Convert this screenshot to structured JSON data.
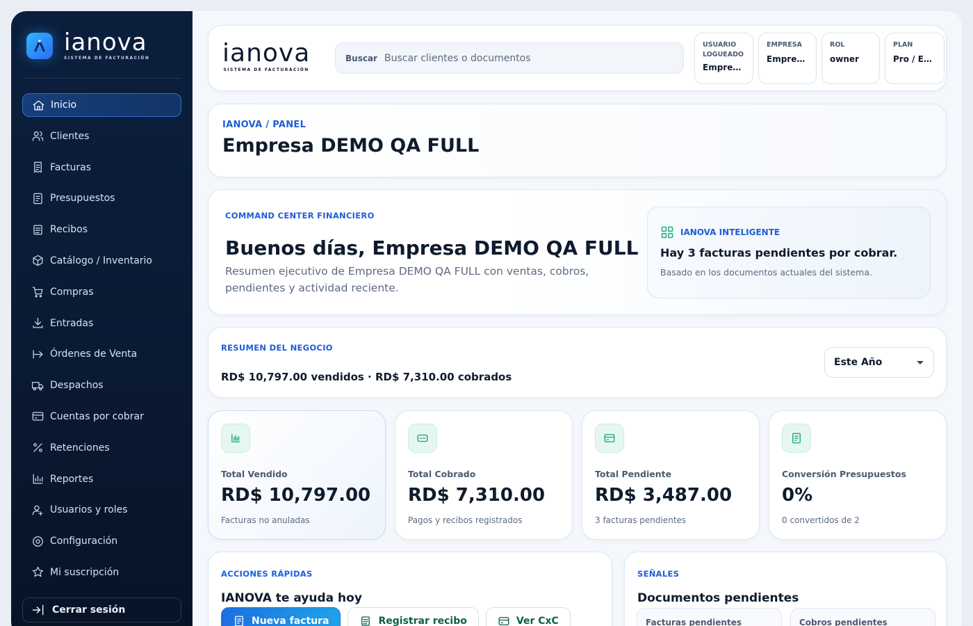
{
  "brand": {
    "name": "ianova",
    "tagline": "SISTEMA DE FACTURACIÓN"
  },
  "nav": {
    "items": [
      {
        "label": "Inicio",
        "icon": "home-icon",
        "active": true
      },
      {
        "label": "Clientes",
        "icon": "users-icon"
      },
      {
        "label": "Facturas",
        "icon": "invoice-icon"
      },
      {
        "label": "Presupuestos",
        "icon": "receipt-icon"
      },
      {
        "label": "Recibos",
        "icon": "document-icon"
      },
      {
        "label": "Catálogo / Inventario",
        "icon": "box-icon"
      },
      {
        "label": "Compras",
        "icon": "cart-icon"
      },
      {
        "label": "Entradas",
        "icon": "download-icon"
      },
      {
        "label": "Órdenes de Venta",
        "icon": "arrow-right-to-icon"
      },
      {
        "label": "Despachos",
        "icon": "truck-icon"
      },
      {
        "label": "Cuentas por cobrar",
        "icon": "credit-card-icon"
      },
      {
        "label": "Retenciones",
        "icon": "percent-icon"
      },
      {
        "label": "Reportes",
        "icon": "bar-chart-icon"
      },
      {
        "label": "Usuarios y roles",
        "icon": "user-gear-icon"
      },
      {
        "label": "Configuración",
        "icon": "settings-icon"
      },
      {
        "label": "Mi suscripción",
        "icon": "star-icon"
      }
    ],
    "logout_label": "Cerrar sesión"
  },
  "topbar": {
    "search_label": "Buscar",
    "search_placeholder": "Buscar clientes o documentos",
    "chips": [
      {
        "key": "USUARIO LOGUEADO",
        "value": "Empres..."
      },
      {
        "key": "EMPRESA",
        "value": "Empres..."
      },
      {
        "key": "ROL",
        "value": "owner"
      },
      {
        "key": "PLAN",
        "value": "Pro / Em..."
      }
    ]
  },
  "panel": {
    "breadcrumb": "IANOVA / PANEL",
    "title": "Empresa DEMO QA FULL"
  },
  "hero": {
    "eyebrow": "COMMAND CENTER FINANCIERO",
    "title": "Buenos días, Empresa DEMO QA FULL",
    "description": "Resumen ejecutivo de Empresa DEMO QA FULL con ventas, cobros, pendientes y actividad reciente.",
    "ai": {
      "label": "IANOVA INTELIGENTE",
      "title": "Hay 3 facturas pendientes por cobrar.",
      "subtitle": "Basado en los documentos actuales del sistema."
    }
  },
  "summary": {
    "eyebrow": "RESUMEN DEL NEGOCIO",
    "line": "RD$ 10,797.00 vendidos · RD$ 7,310.00 cobrados",
    "period": "Este Año"
  },
  "metrics": [
    {
      "label": "Total Vendido",
      "value": "RD$ 10,797.00",
      "note": "Facturas no anuladas",
      "icon": "bar-chart-icon"
    },
    {
      "label": "Total Cobrado",
      "value": "RD$ 7,310.00",
      "note": "Pagos y recibos registrados",
      "icon": "cash-icon"
    },
    {
      "label": "Total Pendiente",
      "value": "RD$ 3,487.00",
      "note": "3 facturas pendientes",
      "icon": "credit-card-icon"
    },
    {
      "label": "Conversión Presupuestos",
      "value": "0%",
      "note": "0 convertidos de 2",
      "icon": "receipt-icon"
    }
  ],
  "actions": {
    "eyebrow": "ACCIONES RÁPIDAS",
    "title": "IANOVA te ayuda hoy",
    "buttons": [
      "Nueva factura",
      "Registrar recibo",
      "Ver CxC"
    ]
  },
  "signals": {
    "eyebrow": "SEÑALES",
    "title": "Documentos pendientes",
    "boxes": [
      "Facturas pendientes",
      "Cobros pendientes"
    ]
  },
  "colors": {
    "sidebar": "#0b1f3d",
    "accent": "#1e5ed6",
    "success": "#17a673"
  }
}
